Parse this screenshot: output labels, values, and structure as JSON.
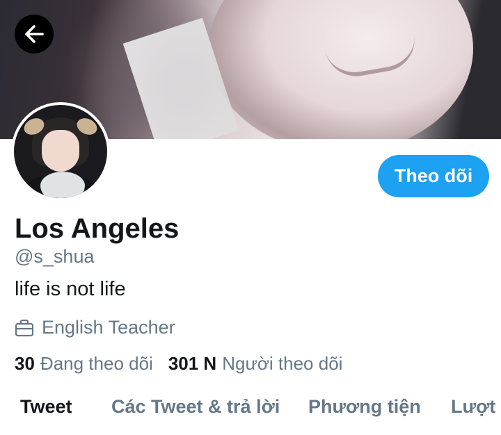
{
  "header": {
    "back_icon": "arrow-left-icon",
    "follow_label": "Theo dõi"
  },
  "profile": {
    "name": "Los Angeles",
    "handle": "@s_shua",
    "bio": "life is not life",
    "job_icon": "briefcase-icon",
    "job": "English Teacher"
  },
  "stats": {
    "following_count": "30",
    "following_label": "Đang theo dõi",
    "followers_count": "301 N",
    "followers_label": "Người theo dõi"
  },
  "tabs": [
    {
      "label": "Tweet",
      "active": true
    },
    {
      "label": "Các Tweet & trả lời",
      "active": false
    },
    {
      "label": "Phương tiện",
      "active": false
    },
    {
      "label": "Lượt t",
      "active": false
    }
  ],
  "colors": {
    "accent": "#1da1f2",
    "primary_text": "#14171a",
    "secondary_text": "#657786"
  }
}
